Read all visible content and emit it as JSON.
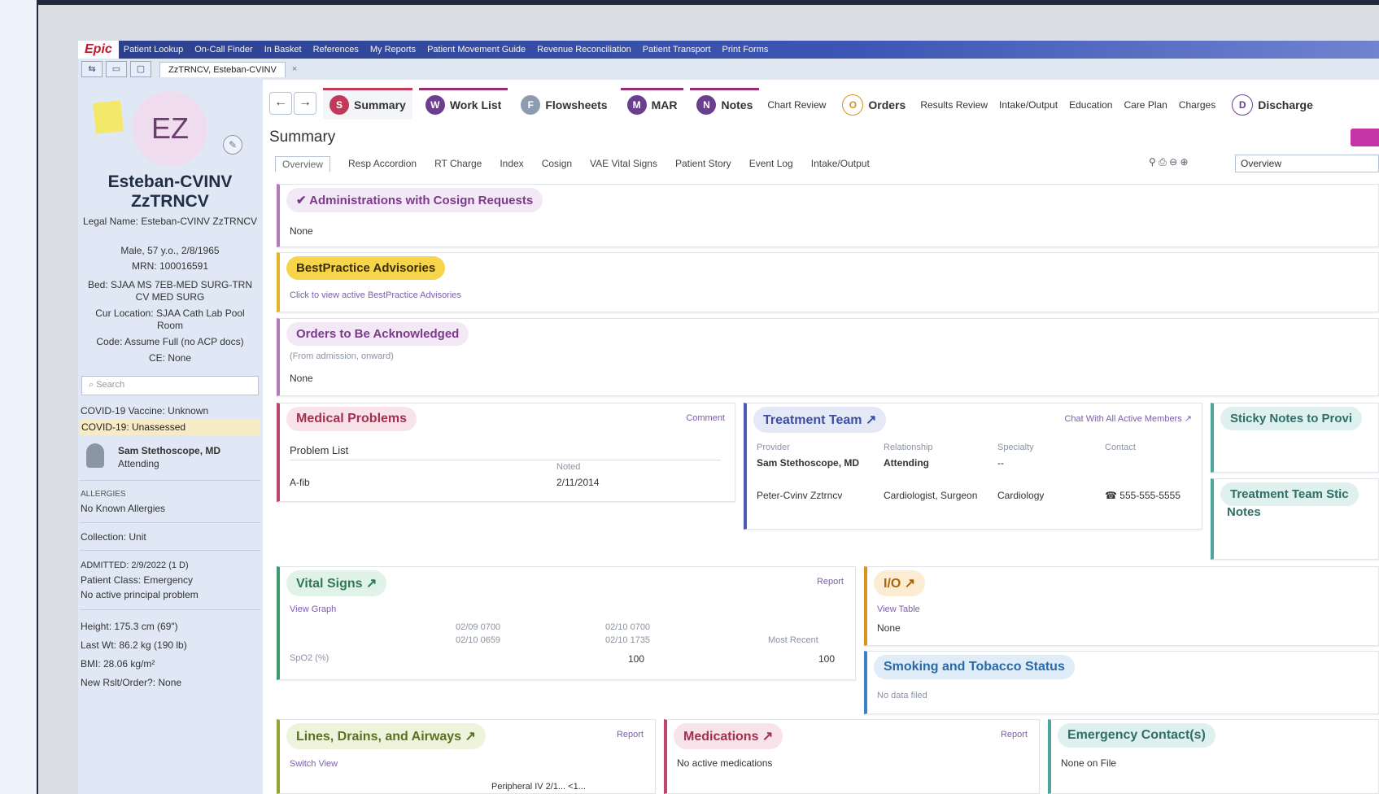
{
  "top_bar": {
    "logo": "Epic",
    "items": [
      "Patient Lookup",
      "On-Call Finder",
      "In Basket",
      "References",
      "My Reports",
      "Patient Movement Guide",
      "Revenue Reconciliation",
      "Patient Transport",
      "Print Forms"
    ]
  },
  "patient_tab": {
    "label": "ZzTRNCV, Esteban-CVINV",
    "close": "×"
  },
  "sidebar": {
    "initials": "EZ",
    "name_line1": "Esteban-CVINV",
    "name_line2": "ZzTRNCV",
    "legal_name": "Legal Name: Esteban-CVINV ZzTRNCV",
    "demographics": "Male, 57 y.o., 2/8/1965",
    "mrn": "MRN: 100016591",
    "bed": "Bed: SJAA MS 7EB-MED SURG-TRN CV MED SURG",
    "location": "Cur Location: SJAA Cath Lab Pool Room",
    "code": "Code: Assume Full (no ACP docs)",
    "ce": "CE: None",
    "search_placeholder": "Search",
    "covid_vaccine": "COVID-19 Vaccine: Unknown",
    "covid": "COVID-19: Unassessed",
    "attending_name": "Sam Stethoscope, MD",
    "attending_role": "Attending",
    "allergies_head": "ALLERGIES",
    "allergies": "No Known Allergies",
    "collection": "Collection: Unit",
    "admitted": "ADMITTED: 2/9/2022 (1 D)",
    "patient_class": "Patient Class: Emergency",
    "principal_problem": "No active principal problem",
    "height": "Height: 175.3 cm (69\")",
    "last_wt": "Last Wt: 86.2 kg (190 lb)",
    "bmi": "BMI: 28.06 kg/m²",
    "new_rslt": "New Rslt/Order?: None"
  },
  "activities": {
    "summary": "Summary",
    "work_list": "Work List",
    "flowsheets": "Flowsheets",
    "mar": "MAR",
    "notes": "Notes",
    "chart_review": "Chart Review",
    "orders": "Orders",
    "results_review": "Results Review",
    "intake_output": "Intake/Output",
    "education": "Education",
    "care_plan": "Care Plan",
    "charges": "Charges",
    "discharge": "Discharge"
  },
  "summary_title": "Summary",
  "subtabs": [
    "Overview",
    "Resp Accordion",
    "RT Charge",
    "Index",
    "Cosign",
    "VAE Vital Signs",
    "Patient Story",
    "Event Log",
    "Intake/Output"
  ],
  "overview_select": "Overview",
  "cards": {
    "cosign": {
      "title": "✔ Administrations with Cosign Requests",
      "value": "None"
    },
    "bpa": {
      "title": "BestPractice Advisories",
      "link": "Click to view active BestPractice Advisories"
    },
    "orders_ack": {
      "title": "Orders to Be Acknowledged",
      "sub": "(From admission, onward)",
      "value": "None"
    },
    "medical_problems": {
      "title": "Medical Problems",
      "comment": "Comment",
      "list_head": "Problem List",
      "noted_head": "Noted",
      "problem": "A-fib",
      "noted": "2/11/2014"
    },
    "treatment_team": {
      "title": "Treatment Team ↗",
      "chat": "Chat With All Active Members ↗",
      "headers": [
        "Provider",
        "Relationship",
        "Specialty",
        "Contact"
      ],
      "rows": [
        [
          "Sam Stethoscope, MD",
          "Attending",
          "--",
          ""
        ],
        [
          "Peter-Cvinv Zztrncv",
          "Cardiologist, Surgeon",
          "Cardiology",
          "555-555-5555"
        ]
      ]
    },
    "sticky_notes": {
      "title": "Sticky Notes to Provi"
    },
    "team_sticky": {
      "title": "Treatment Team Stic",
      "title2": "Notes"
    },
    "vital_signs": {
      "title": "Vital Signs ↗",
      "report": "Report",
      "graph": "View Graph",
      "col1a": "02/09 0700",
      "col1b": "02/10 0659",
      "col2a": "02/10 0700",
      "col2b": "02/10 1735",
      "recent": "Most Recent",
      "row_label": "SpO2 (%)",
      "v1": "100",
      "v2": "100"
    },
    "io": {
      "title": "I/O ↗",
      "table": "View Table",
      "value": "None"
    },
    "smoking": {
      "title": "Smoking and Tobacco Status",
      "value": "No data filed"
    },
    "lines": {
      "title": "Lines, Drains, and Airways ↗",
      "report": "Report",
      "switch": "Switch View",
      "item": "Peripheral IV 2/1... <1..."
    },
    "medications": {
      "title": "Medications ↗",
      "report": "Report",
      "value": "No active medications"
    },
    "emergency": {
      "title": "Emergency Contact(s)",
      "value": "None on File"
    }
  }
}
